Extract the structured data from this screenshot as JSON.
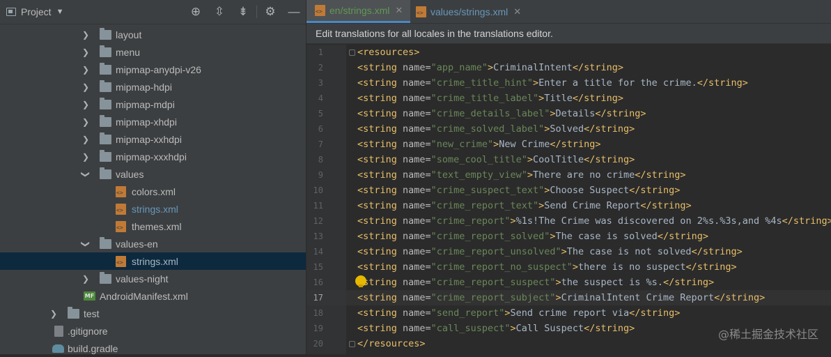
{
  "project_panel": {
    "title": "Project",
    "toolbar_icons": [
      "crosshair-icon",
      "expand-all-icon",
      "collapse-all-icon",
      "gear-icon",
      "minimize-icon"
    ]
  },
  "tree": {
    "items": [
      {
        "label": "layout",
        "type": "folder",
        "expanded": false
      },
      {
        "label": "menu",
        "type": "folder",
        "expanded": false
      },
      {
        "label": "mipmap-anydpi-v26",
        "type": "folder",
        "expanded": false
      },
      {
        "label": "mipmap-hdpi",
        "type": "folder",
        "expanded": false
      },
      {
        "label": "mipmap-mdpi",
        "type": "folder",
        "expanded": false
      },
      {
        "label": "mipmap-xhdpi",
        "type": "folder",
        "expanded": false
      },
      {
        "label": "mipmap-xxhdpi",
        "type": "folder",
        "expanded": false
      },
      {
        "label": "mipmap-xxxhdpi",
        "type": "folder",
        "expanded": false
      },
      {
        "label": "values",
        "type": "folder",
        "expanded": true
      },
      {
        "label": "colors.xml",
        "type": "xml"
      },
      {
        "label": "strings.xml",
        "type": "xml"
      },
      {
        "label": "themes.xml",
        "type": "xml"
      },
      {
        "label": "values-en",
        "type": "folder",
        "expanded": true
      },
      {
        "label": "strings.xml",
        "type": "xml",
        "selected": true
      },
      {
        "label": "values-night",
        "type": "folder",
        "expanded": false
      },
      {
        "label": "AndroidManifest.xml",
        "type": "manifest",
        "icon_text": "MF"
      },
      {
        "label": "test",
        "type": "folder",
        "expanded": false
      },
      {
        "label": ".gitignore",
        "type": "file"
      },
      {
        "label": "build.gradle",
        "type": "gradle"
      }
    ]
  },
  "tabs": [
    {
      "label": "en/strings.xml",
      "active": true
    },
    {
      "label": "values/strings.xml",
      "active": false
    }
  ],
  "banner": {
    "text": "Edit translations for all locales in the translations editor."
  },
  "editor": {
    "current_line": 17,
    "lines": [
      {
        "num": "1",
        "open": "<resources>"
      },
      {
        "num": "2",
        "name": "app_name",
        "text": "CriminalIntent"
      },
      {
        "num": "3",
        "name": "crime_title_hint",
        "text": "Enter a title for the crime."
      },
      {
        "num": "4",
        "name": "crime_title_label",
        "text": "Title"
      },
      {
        "num": "5",
        "name": "crime_details_label",
        "text": "Details"
      },
      {
        "num": "6",
        "name": "crime_solved_label",
        "text": "Solved"
      },
      {
        "num": "7",
        "name": "new_crime",
        "text": "New Crime"
      },
      {
        "num": "8",
        "name": "some_cool_title",
        "text": "CoolTitle"
      },
      {
        "num": "9",
        "name": "text_empty_view",
        "text": "There are no crime"
      },
      {
        "num": "10",
        "name": "crime_suspect_text",
        "text": "Choose Suspect"
      },
      {
        "num": "11",
        "name": "crime_report_text",
        "text": "Send Crime Report"
      },
      {
        "num": "12",
        "name": "crime_report",
        "text": "%1s!The Crime was discovered on 2%s.%3s,and %4s"
      },
      {
        "num": "13",
        "name": "crime_report_solved",
        "text": "The case is solved"
      },
      {
        "num": "14",
        "name": "crime_report_unsolved",
        "text": "The case is not solved"
      },
      {
        "num": "15",
        "name": "crime_report_no_suspect",
        "text": "there is no suspect"
      },
      {
        "num": "16",
        "name": "crime_report_suspect",
        "text": "the suspect is %s."
      },
      {
        "num": "17",
        "name": "crime_report_subject",
        "text": "CriminalIntent Crime Report"
      },
      {
        "num": "18",
        "name": "send_report",
        "text": "Send crime report via"
      },
      {
        "num": "19",
        "name": "call_suspect",
        "text": "Call Suspect"
      },
      {
        "num": "20",
        "close": "</resources>"
      }
    ]
  },
  "watermark": "@稀土掘金技术社区",
  "colors": {
    "accent": "#4a88c7",
    "tag": "#e8bf6a",
    "value": "#6a8759",
    "selection": "#0d293e"
  }
}
